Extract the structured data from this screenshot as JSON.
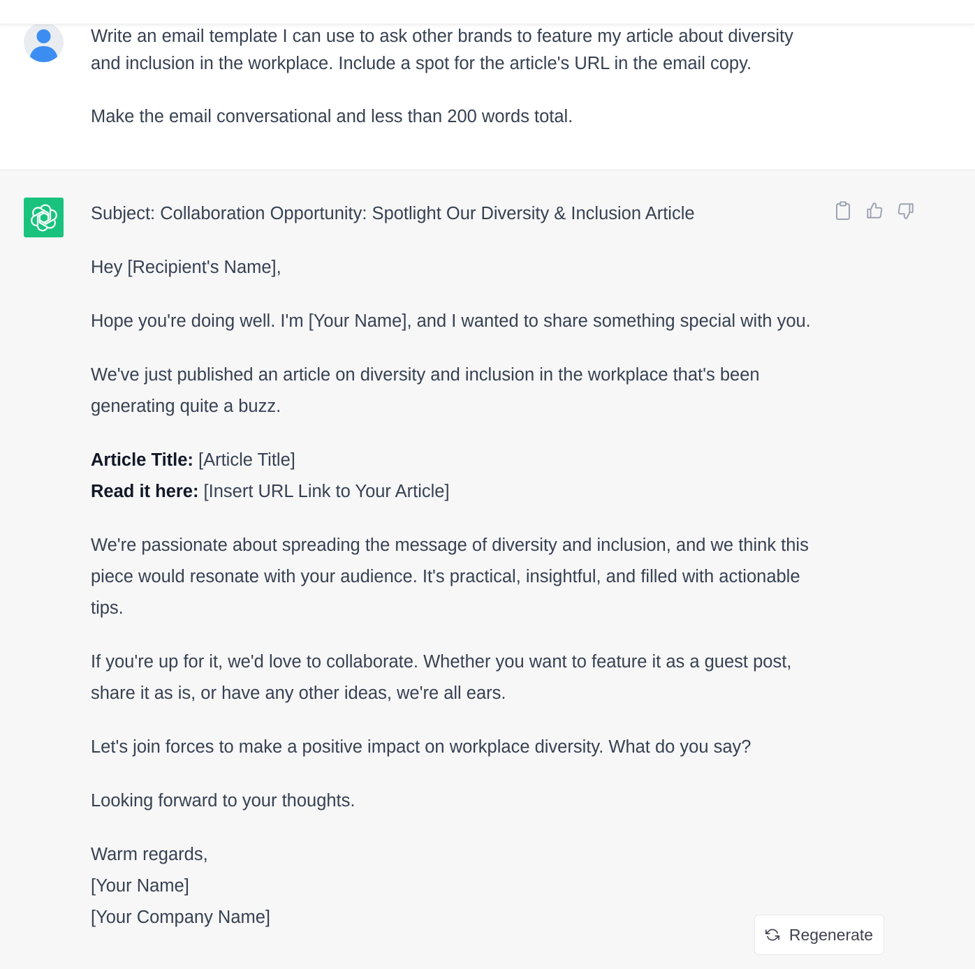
{
  "user_message": {
    "paragraphs": [
      "Write an email template I can use to ask other brands to feature my article about diversity and inclusion in the workplace. Include a spot for the article's URL in the email copy.",
      "Make the email conversational and less than 200 words total."
    ]
  },
  "assistant_message": {
    "subject": "Subject: Collaboration Opportunity: Spotlight Our Diversity & Inclusion Article",
    "greeting": "Hey [Recipient's Name],",
    "intro": "Hope you're doing well. I'm [Your Name], and I wanted to share something special with you.",
    "published": "We've just published an article on diversity and inclusion in the workplace that's been generating quite a buzz.",
    "article_title_label": "Article Title:",
    "article_title_value": " [Article Title]",
    "read_label": "Read it here:",
    "read_value": " [Insert URL Link to Your Article]",
    "passion": "We're passionate about spreading the message of diversity and inclusion, and we think this piece would resonate with your audience. It's practical, insightful, and filled with actionable tips.",
    "collab": "If you're up for it, we'd love to collaborate. Whether you want to feature it as a guest post, share it as is, or have any other ideas, we're all ears.",
    "join": "Let's join forces to make a positive impact on workplace diversity. What do you say?",
    "forward": "Looking forward to your thoughts.",
    "signoff": "Warm regards,",
    "sig_name": "[Your Name]",
    "sig_company": "[Your Company Name]"
  },
  "actions": {
    "icons": [
      "clipboard-icon",
      "thumbs-up-icon",
      "thumbs-down-icon"
    ]
  },
  "regenerate": {
    "label": "Regenerate",
    "icon": "refresh-icon"
  },
  "colors": {
    "assistant_accent": "#19c37d",
    "user_avatar": "#3b8df1",
    "assistant_bg": "#f7f7f8",
    "text": "#374151"
  }
}
